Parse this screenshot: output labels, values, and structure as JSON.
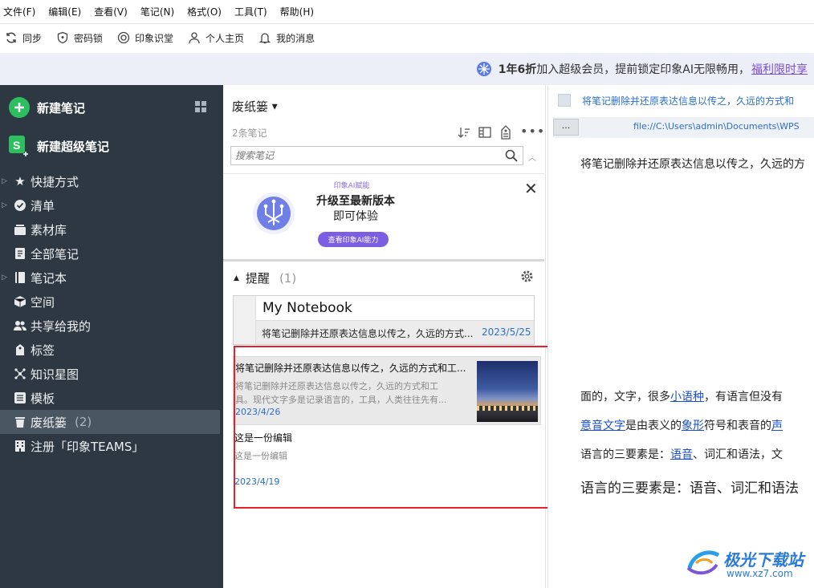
{
  "menu": [
    "文件(F)",
    "编辑(E)",
    "查看(V)",
    "笔记(N)",
    "格式(O)",
    "工具(T)",
    "帮助(H)"
  ],
  "toolbar": {
    "sync": "同步",
    "lock": "密码锁",
    "classroom": "印象识堂",
    "profile": "个人主页",
    "messages": "我的消息"
  },
  "banner": {
    "bold": "1年6折",
    "text": "加入超级会员，提前锁定印象AI无限畅用，",
    "link": "福利限时享"
  },
  "sidebar": {
    "new_note": "新建笔记",
    "new_super_note": "新建超级笔记",
    "items": [
      {
        "label": "快捷方式",
        "icon": "star-icon"
      },
      {
        "label": "清单",
        "icon": "check-circle-icon"
      },
      {
        "label": "素材库",
        "icon": "library-icon"
      },
      {
        "label": "全部笔记",
        "icon": "note-icon"
      },
      {
        "label": "笔记本",
        "icon": "notebook-icon"
      },
      {
        "label": "空间",
        "icon": "cube-icon"
      },
      {
        "label": "共享给我的",
        "icon": "people-icon"
      },
      {
        "label": "标签",
        "icon": "tag-icon"
      },
      {
        "label": "知识星图",
        "icon": "graph-icon"
      },
      {
        "label": "模板",
        "icon": "template-icon"
      },
      {
        "label": "废纸篓",
        "icon": "trash-icon",
        "count": "(2)"
      },
      {
        "label": "注册「印象TEAMS」",
        "icon": "building-icon"
      }
    ]
  },
  "list": {
    "title": "废纸篓",
    "count": "2条笔记",
    "search_placeholder": "搜索笔记",
    "promo": {
      "small": "印象AI赋能",
      "title": "升级至最新版本",
      "sub": "即可体验",
      "button": "查看印象AI能力"
    },
    "reminder": {
      "label": "提醒",
      "count": "(1)",
      "notebook": "My Notebook",
      "note_title": "将笔记删除并还原表达信息以传之，久远的方式...",
      "note_date": "2023/5/25"
    },
    "notes": [
      {
        "title": "将笔记删除并还原表达信息以传之，久远的方式和工...",
        "snippet1": "将笔记删除并还原表达信息以传之，久远的方式和工",
        "snippet2": "具。现代文字多是记录语言的，工具，人类往往先有...",
        "date": "2023/4/26"
      },
      {
        "title": "这是一份编辑",
        "snippet1": "这是一份编辑",
        "date": "2023/4/19"
      }
    ]
  },
  "detail": {
    "title": "将笔记删除并还原表达信息以传之，久远的方式和",
    "more_btn": "...",
    "file_path": "file://C:\\Users\\admin\\Documents\\WPS",
    "line1": "将笔记删除并还原表达信息以传之，久远的方",
    "p1_pre": "面的，文字，很多",
    "p1_link": "小语种",
    "p1_post": "，有语言但没有",
    "p2_link1": "意音文字",
    "p2_mid": "是由表义的",
    "p2_link2": "象形",
    "p2_mid2": "符号和表音的",
    "p2_link3": "声",
    "p3_pre": "语言的三要素是：",
    "p3_link": "语音",
    "p3_post": "、词汇和语法，文",
    "p4": "语言的三要素是：语音、词汇和语法"
  },
  "watermark": {
    "name": "极光下载站",
    "url": "www.xz7.com"
  }
}
